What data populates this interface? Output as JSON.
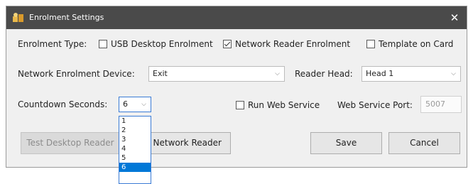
{
  "window": {
    "title": "Enrolment Settings",
    "close_glyph": "✕"
  },
  "enrolment_type": {
    "label": "Enrolment Type:",
    "options": [
      {
        "label": "USB Desktop Enrolment",
        "checked": false
      },
      {
        "label": "Network Reader Enrolment",
        "checked": true
      },
      {
        "label": "Template on Card",
        "checked": false
      }
    ]
  },
  "network_device": {
    "label": "Network Enrolment Device:",
    "value": "Exit"
  },
  "reader_head": {
    "label": "Reader Head:",
    "value": "Head 1"
  },
  "countdown": {
    "label": "Countdown Seconds:",
    "value": "6",
    "options": [
      "1",
      "2",
      "3",
      "4",
      "5",
      "6"
    ],
    "selected_option": "6"
  },
  "web_service": {
    "run_label": "Run Web Service",
    "run_checked": false,
    "port_label": "Web Service Port:",
    "port_value": "5007"
  },
  "buttons": {
    "test_desktop": "Test Desktop Reader",
    "test_network": "Test Network Reader",
    "save": "Save",
    "cancel": "Cancel"
  },
  "icons": {
    "title": "app-settings-icon",
    "dropdown_arrow": "chevron-down-icon",
    "close": "close-icon"
  },
  "colors": {
    "titlebar": "#4a4a4a",
    "selection": "#0078d7",
    "focus_border": "#3a7bd5"
  }
}
